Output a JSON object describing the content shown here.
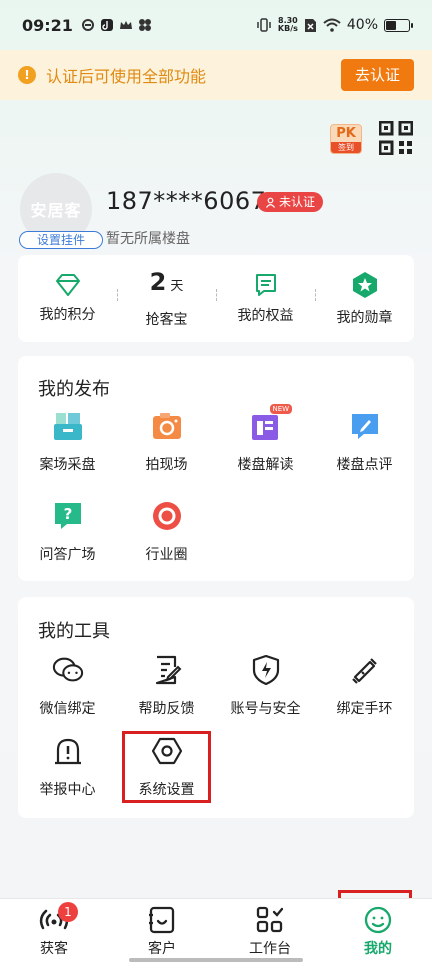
{
  "status_bar": {
    "time": "09:21",
    "net_speed_value": "8.30",
    "net_speed_unit": "KB/s",
    "battery": "40%",
    "battery_level": 0.4
  },
  "banner": {
    "text": "认证后可使用全部功能",
    "button": "去认证"
  },
  "top_icons": {
    "pk_label": "PK",
    "checkin_label": "签到"
  },
  "profile": {
    "avatar_text": "安居客",
    "plugin_button": "设置挂件",
    "phone": "187****6067",
    "verify_status": "未认证",
    "house_status": "暂无所属楼盘"
  },
  "stats": [
    {
      "label": "我的积分",
      "icon": "diamond-icon"
    },
    {
      "label": "抢客宝",
      "value": "2",
      "unit": "天"
    },
    {
      "label": "我的权益",
      "icon": "document-icon"
    },
    {
      "label": "我的勋章",
      "icon": "medal-star-icon"
    }
  ],
  "publish": {
    "title": "我的发布",
    "items": [
      {
        "label": "案场采盘",
        "icon": "folder-box-icon"
      },
      {
        "label": "拍现场",
        "icon": "camera-icon"
      },
      {
        "label": "楼盘解读",
        "icon": "article-icon",
        "badge": "NEW"
      },
      {
        "label": "楼盘点评",
        "icon": "pen-comment-icon"
      },
      {
        "label": "问答广场",
        "icon": "question-icon"
      },
      {
        "label": "行业圈",
        "icon": "circle-icon"
      }
    ]
  },
  "tools": {
    "title": "我的工具",
    "items": [
      {
        "label": "微信绑定",
        "icon": "wechat-icon"
      },
      {
        "label": "帮助反馈",
        "icon": "feedback-icon"
      },
      {
        "label": "账号与安全",
        "icon": "shield-bolt-icon"
      },
      {
        "label": "绑定手环",
        "icon": "wristband-icon"
      },
      {
        "label": "举报中心",
        "icon": "alert-icon"
      },
      {
        "label": "系统设置",
        "icon": "settings-hexagon-icon"
      }
    ]
  },
  "bottom_nav": [
    {
      "label": "获客",
      "badge": "1",
      "icon": "signal-icon"
    },
    {
      "label": "客户",
      "icon": "contacts-icon"
    },
    {
      "label": "工作台",
      "icon": "grid-icon"
    },
    {
      "label": "我的",
      "icon": "profile-icon",
      "active": true
    }
  ],
  "colors": {
    "accent_green": "#17a86b",
    "warning_orange": "#f07a10",
    "highlight_red": "#d82020"
  }
}
